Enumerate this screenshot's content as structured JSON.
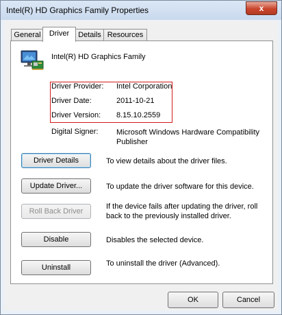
{
  "window": {
    "title": "Intel(R) HD Graphics Family Properties",
    "close_glyph": "x"
  },
  "tabs": [
    {
      "label": "General"
    },
    {
      "label": "Driver",
      "active": true
    },
    {
      "label": "Details"
    },
    {
      "label": "Resources"
    }
  ],
  "device": {
    "name": "Intel(R) HD Graphics Family",
    "icon": "display-adapter-icon"
  },
  "driver_info": {
    "provider_label": "Driver Provider:",
    "provider_value": "Intel Corporation",
    "date_label": "Driver Date:",
    "date_value": "2011-10-21",
    "version_label": "Driver Version:",
    "version_value": "8.15.10.2559",
    "signer_label": "Digital Signer:",
    "signer_value": "Microsoft Windows Hardware Compatibility Publisher",
    "highlight_color": "#d11a1a"
  },
  "actions": [
    {
      "label": "Driver Details",
      "description": "To view details about the driver files.",
      "enabled": true
    },
    {
      "label": "Update Driver...",
      "description": "To update the driver software for this device.",
      "enabled": true
    },
    {
      "label": "Roll Back Driver",
      "description": "If the device fails after updating the driver, roll back to the previously installed driver.",
      "enabled": false
    },
    {
      "label": "Disable",
      "description": "Disables the selected device.",
      "enabled": true
    },
    {
      "label": "Uninstall",
      "description": "To uninstall the driver (Advanced).",
      "enabled": true
    }
  ],
  "dialog_buttons": {
    "ok": "OK",
    "cancel": "Cancel"
  }
}
